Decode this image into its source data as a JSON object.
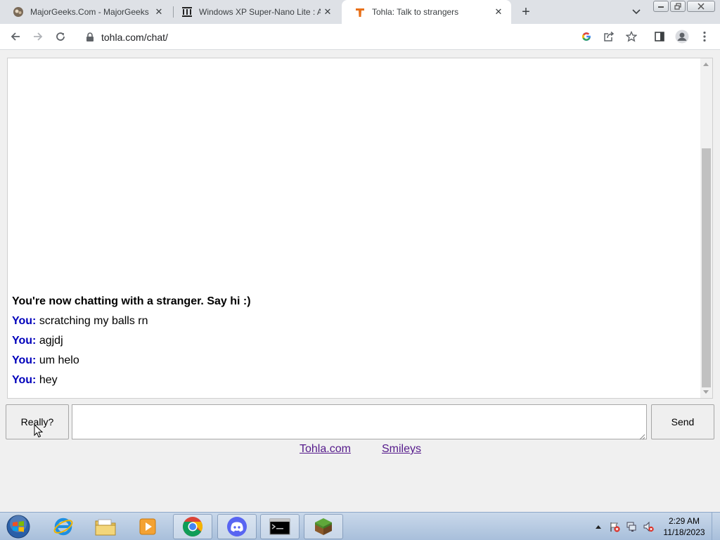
{
  "browser": {
    "tabs": [
      {
        "title": "MajorGeeks.Com - MajorGeeks",
        "icon": "majorgeeks-favicon",
        "active": false
      },
      {
        "title": "Windows XP Super-Nano Lite : Al",
        "icon": "archive-org-favicon",
        "active": false
      },
      {
        "title": "Tohla: Talk to strangers",
        "icon": "tohla-favicon",
        "active": true
      }
    ],
    "new_tab": "+",
    "url": "tohla.com/chat/"
  },
  "chat": {
    "status": "You're now chatting with a stranger. Say hi :)",
    "messages": [
      {
        "sender": "You:",
        "text": "scratching my balls rn"
      },
      {
        "sender": "You:",
        "text": "agjdj"
      },
      {
        "sender": "You:",
        "text": "um helo"
      },
      {
        "sender": "You:",
        "text": "hey"
      }
    ],
    "stop_button": "Really?",
    "send_button": "Send",
    "input_value": ""
  },
  "footer_links": {
    "home": "Tohla.com",
    "smileys": "Smileys"
  },
  "taskbar": {
    "apps": [
      "internet-explorer-icon",
      "file-explorer-icon",
      "media-player-icon",
      "chrome-icon",
      "discord-icon",
      "command-prompt-icon",
      "minecraft-icon"
    ],
    "time": "2:29 AM",
    "date": "11/18/2023"
  },
  "colors": {
    "you_label": "#0000bb",
    "link": "#551a8b",
    "tohla_brand": "#e8711a"
  }
}
